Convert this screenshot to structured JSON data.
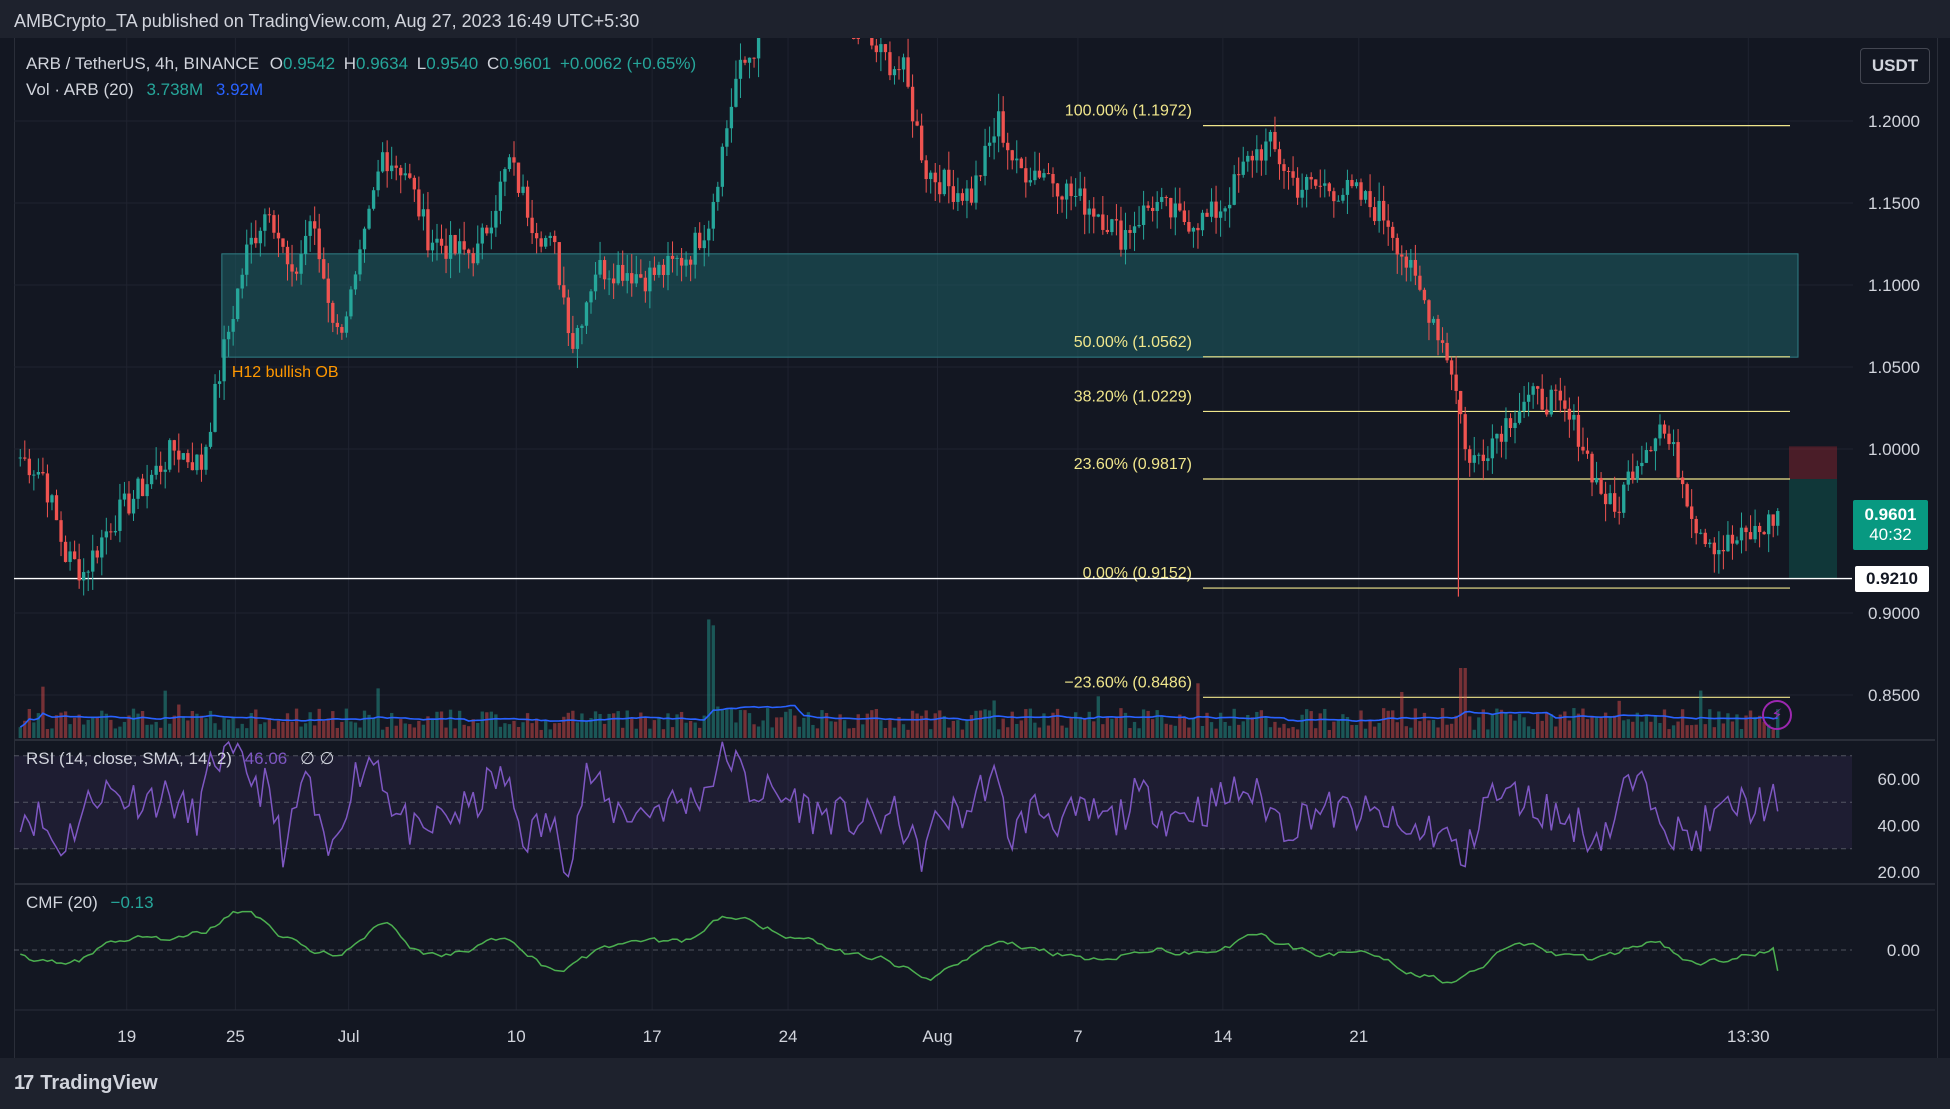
{
  "header": {
    "published_by": "AMBCrypto_TA published on TradingView.com, Aug 27, 2023 16:49 UTC+5:30"
  },
  "footer": {
    "brand": "TradingView",
    "logo_mark": "17"
  },
  "currency_button": "USDT",
  "legend": {
    "symbol": "ARB / TetherUS, 4h, BINANCE",
    "o_label": "O",
    "o_value": "0.9542",
    "h_label": "H",
    "h_value": "0.9634",
    "l_label": "L",
    "l_value": "0.9540",
    "c_label": "C",
    "c_value": "0.9601",
    "change": "+0.0062 (+0.65%)",
    "vol_label": "Vol · ARB (20)",
    "vol_value_1": "3.738M",
    "vol_value_2": "3.92M",
    "rsi_label": "RSI (14, close, SMA, 14, 2)",
    "rsi_value": "46.06",
    "rsi_extra": "∅ ∅",
    "cmf_label": "CMF (20)",
    "cmf_value": "−0.13"
  },
  "price_tag": {
    "price": "0.9601",
    "countdown": "40:32"
  },
  "level_tag": "0.9210",
  "chart_data": [
    {
      "type": "candlestick",
      "title": "ARB / TetherUS, 4h, BINANCE",
      "y_axis_ticks": [
        "1.2000",
        "1.1500",
        "1.1000",
        "1.0500",
        "1.0000",
        "0.9000",
        "0.8500"
      ],
      "ylim": [
        0.826,
        1.246
      ],
      "x_axis_ticks": [
        "19",
        "25",
        "Jul",
        "10",
        "17",
        "24",
        "Aug",
        "7",
        "14",
        "21",
        "13:30"
      ],
      "horizontal_level": 0.921,
      "last_price": 0.9601,
      "fib_levels": [
        {
          "label": "100.00% (1.1972)",
          "value": 1.1972
        },
        {
          "label": "50.00% (1.0562)",
          "value": 1.0562
        },
        {
          "label": "38.20% (1.0229)",
          "value": 1.0229
        },
        {
          "label": "23.60% (0.9817)",
          "value": 0.9817
        },
        {
          "label": "0.00% (0.9152)",
          "value": 0.9152
        },
        {
          "label": "−23.60% (0.8486)",
          "value": 0.8486
        }
      ],
      "order_block": {
        "label": "H12 bullish OB",
        "top": 1.119,
        "bottom": 1.056
      },
      "close_path": [
        [
          0,
          0.995
        ],
        [
          5,
          0.985
        ],
        [
          10,
          0.935
        ],
        [
          14,
          0.925
        ],
        [
          20,
          0.955
        ],
        [
          28,
          0.98
        ],
        [
          34,
          1.0
        ],
        [
          40,
          0.99
        ],
        [
          45,
          1.06
        ],
        [
          50,
          1.12
        ],
        [
          55,
          1.15
        ],
        [
          60,
          1.1
        ],
        [
          64,
          1.14
        ],
        [
          70,
          1.07
        ],
        [
          74,
          1.1
        ],
        [
          80,
          1.18
        ],
        [
          85,
          1.17
        ],
        [
          90,
          1.13
        ],
        [
          96,
          1.12
        ],
        [
          101,
          1.12
        ],
        [
          108,
          1.175
        ],
        [
          113,
          1.14
        ],
        [
          118,
          1.12
        ],
        [
          122,
          1.065
        ],
        [
          127,
          1.11
        ],
        [
          133,
          1.11
        ],
        [
          138,
          1.105
        ],
        [
          143,
          1.11
        ],
        [
          148,
          1.12
        ],
        [
          152,
          1.14
        ],
        [
          158,
          1.225
        ],
        [
          165,
          1.26
        ],
        [
          172,
          1.28
        ],
        [
          180,
          1.27
        ],
        [
          190,
          1.24
        ],
        [
          195,
          1.23
        ],
        [
          200,
          1.17
        ],
        [
          205,
          1.16
        ],
        [
          210,
          1.155
        ],
        [
          216,
          1.2
        ],
        [
          220,
          1.17
        ],
        [
          226,
          1.17
        ],
        [
          232,
          1.155
        ],
        [
          238,
          1.145
        ],
        [
          243,
          1.13
        ],
        [
          250,
          1.15
        ],
        [
          256,
          1.14
        ],
        [
          262,
          1.14
        ],
        [
          266,
          1.15
        ],
        [
          272,
          1.18
        ],
        [
          276,
          1.185
        ],
        [
          282,
          1.16
        ],
        [
          288,
          1.16
        ],
        [
          295,
          1.155
        ],
        [
          302,
          1.14
        ],
        [
          308,
          1.1
        ],
        [
          312,
          1.08
        ],
        [
          316,
          1.05
        ],
        [
          320,
          0.99
        ],
        [
          326,
          1.01
        ],
        [
          332,
          1.03
        ],
        [
          338,
          1.03
        ],
        [
          344,
          1.01
        ],
        [
          348,
          0.98
        ],
        [
          352,
          0.96
        ],
        [
          356,
          0.99
        ],
        [
          362,
          1.015
        ],
        [
          366,
          0.99
        ],
        [
          370,
          0.955
        ],
        [
          375,
          0.94
        ],
        [
          380,
          0.945
        ],
        [
          384,
          0.95
        ],
        [
          388,
          0.9601
        ]
      ]
    },
    {
      "type": "bar",
      "title": "Vol · ARB (20)",
      "last_values": [
        "3.738M",
        "3.92M"
      ]
    },
    {
      "type": "line",
      "title": "RSI (14, close, SMA, 14, 2)",
      "y_axis_ticks": [
        "60.00",
        "40.00",
        "20.00"
      ],
      "ylim": [
        16,
        80
      ],
      "band": [
        30,
        70
      ],
      "last_value": 46.06
    },
    {
      "type": "line",
      "title": "CMF (20)",
      "y_axis_ticks": [
        "0.00"
      ],
      "last_value": -0.13
    }
  ]
}
